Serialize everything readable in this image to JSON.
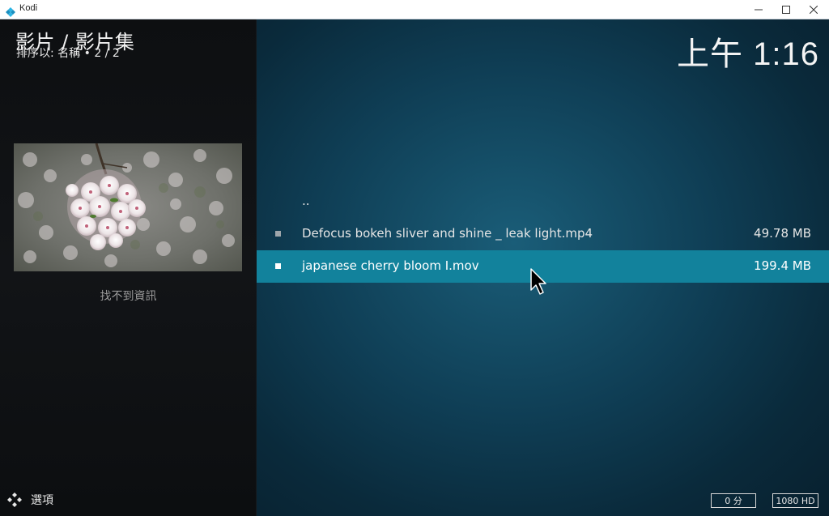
{
  "window": {
    "title": "Kodi"
  },
  "header": {
    "title": "影片 / 影片集",
    "subtitle": "排序以: 名稱 • 2 / 2"
  },
  "clock": "上午 1:16",
  "info_panel": {
    "no_info_text": "找不到資訊"
  },
  "file_list": [
    {
      "name": "..",
      "size": "",
      "selected": false
    },
    {
      "name": "Defocus bokeh sliver and shine _ leak light.mp4",
      "size": "49.78 MB",
      "selected": false
    },
    {
      "name": "japanese cherry bloom I.mov",
      "size": "199.4 MB",
      "selected": true
    }
  ],
  "footer": {
    "options_label": "選項",
    "duration_badge": "0 分",
    "resolution_badge": "1080 HD"
  },
  "colors": {
    "selection": "#12829c",
    "background_center": "#1a5d78",
    "background_edge": "#08202e"
  },
  "icons": {
    "app": "kodi-icon",
    "options": "options-icon",
    "minimize": "minimize-icon",
    "maximize": "maximize-icon",
    "close": "close-icon"
  }
}
